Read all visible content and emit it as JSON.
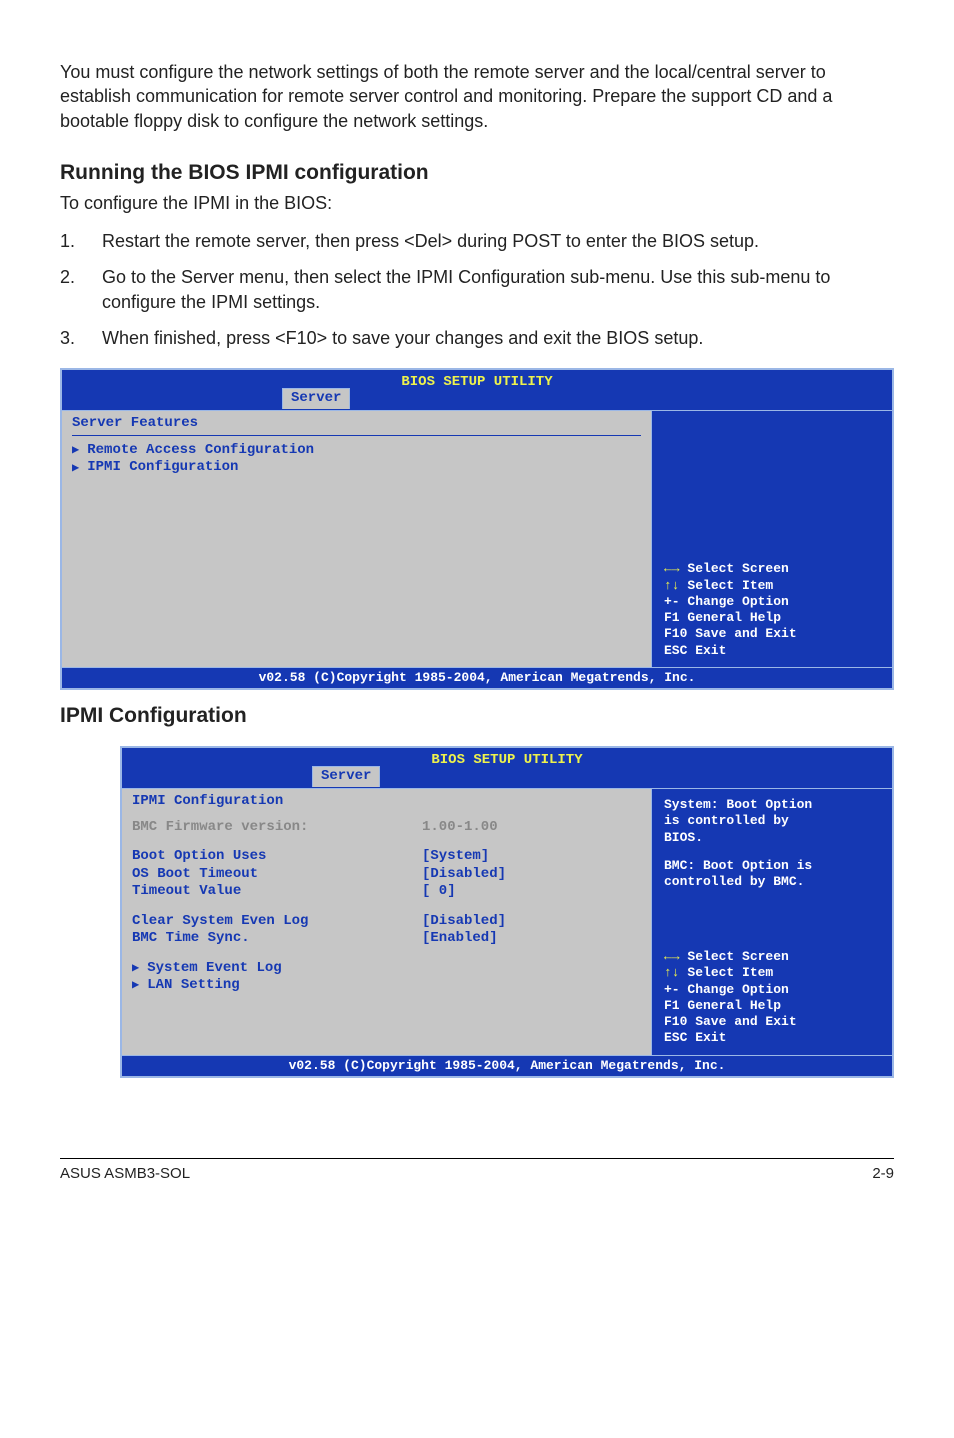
{
  "intro": "You must configure the network settings of both the remote server and the local/central server to establish communication for remote server control and monitoring. Prepare the support CD and a bootable floppy disk to configure the network settings.",
  "section1": {
    "heading": "Running the BIOS IPMI configuration",
    "lead": "To configure the IPMI in the BIOS:",
    "steps": [
      {
        "n": "1.",
        "text": "Restart the remote server, then press <Del> during POST to enter the BIOS setup."
      },
      {
        "n": "2.",
        "text": "Go to the Server menu, then select the IPMI Configuration sub-menu. Use this sub-menu to configure the IPMI settings."
      },
      {
        "n": "3.",
        "text": "When finished, press <F10> to save your changes and exit the BIOS setup."
      }
    ]
  },
  "bios1": {
    "title": "BIOS SETUP UTILITY",
    "tab": "Server",
    "left_title": "Server Features",
    "items": [
      "Remote Access Configuration",
      "IPMI Configuration"
    ],
    "help": "   Select Screen\n   Select Item\n+- Change Option\nF1 General Help\nF10 Save and Exit\nESC Exit",
    "footer": "v02.58 (C)Copyright 1985-2004, American Megatrends, Inc."
  },
  "section2": {
    "heading": "IPMI Configuration"
  },
  "bios2": {
    "title": "BIOS SETUP UTILITY",
    "tab": "Server",
    "left_title": "IPMI Configuration",
    "fw_label": "BMC Firmware version:",
    "fw_value": "1.00-1.00",
    "fields": [
      {
        "label": "Boot Option Uses",
        "value": "[System]"
      },
      {
        "label": "OS Boot Timeout",
        "value": "[Disabled]"
      },
      {
        "label": "Timeout Value",
        "value": "[  0]"
      }
    ],
    "fields2": [
      {
        "label": "Clear System Even Log",
        "value": "[Disabled]"
      },
      {
        "label": "BMC Time Sync.",
        "value": "[Enabled]"
      }
    ],
    "subitems": [
      "System Event Log",
      "LAN Setting"
    ],
    "right_top1": "System: Boot Option\nis controlled by\nBIOS.",
    "right_top2": "BMC: Boot Option is\ncontrolled by BMC.",
    "help": "   Select Screen\n   Select Item\n+- Change Option\nF1 General Help\nF10 Save and Exit\nESC Exit",
    "footer": "v02.58 (C)Copyright 1985-2004, American Megatrends, Inc."
  },
  "footer": {
    "left": "ASUS ASMB3-SOL",
    "right": "2-9"
  }
}
